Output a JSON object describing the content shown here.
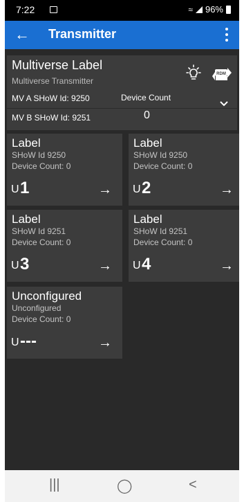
{
  "status_bar": {
    "time": "7:22",
    "battery": "96%"
  },
  "app_bar": {
    "back_icon": "arrow-left-icon",
    "title": "Transmitter",
    "menu_icon": "more-vertical-icon"
  },
  "multiverse": {
    "label": "Multiverse Label",
    "subtitle": "Multiverse Transmitter",
    "mv_a_id": "MV A SHoW Id: 9250",
    "mv_b_id": "MV B SHoW Id: 9251",
    "device_count_label": "Device Count",
    "device_count_value": "0",
    "icons": [
      "lightbulb-icon",
      "rdm-icon",
      "chevron-down-icon"
    ]
  },
  "universes": [
    {
      "label": "Label",
      "show_id": "SHoW Id 9250",
      "device_count": "Device Count: 0",
      "letter": "U",
      "number": "1",
      "arrow": "→"
    },
    {
      "label": "Label",
      "show_id": "SHoW Id 9250",
      "device_count": "Device Count: 0",
      "letter": "U",
      "number": "2",
      "arrow": "→"
    },
    {
      "label": "Label",
      "show_id": "SHoW Id 9251",
      "device_count": "Device Count: 0",
      "letter": "U",
      "number": "3",
      "arrow": "→"
    },
    {
      "label": "Label",
      "show_id": "SHoW Id 9251",
      "device_count": "Device Count: 0",
      "letter": "U",
      "number": "4",
      "arrow": "→"
    },
    {
      "label": "Unconfigured",
      "show_id": "Unconfigured",
      "device_count": "Device Count: 0",
      "letter": "U",
      "number": "---",
      "arrow": "→"
    }
  ],
  "nav_bar": {
    "recents": "|||",
    "home": "◯",
    "back": "<"
  },
  "colors": {
    "app_bar": "#1a6fd2",
    "background": "#292929",
    "card": "#3c3c3c"
  }
}
